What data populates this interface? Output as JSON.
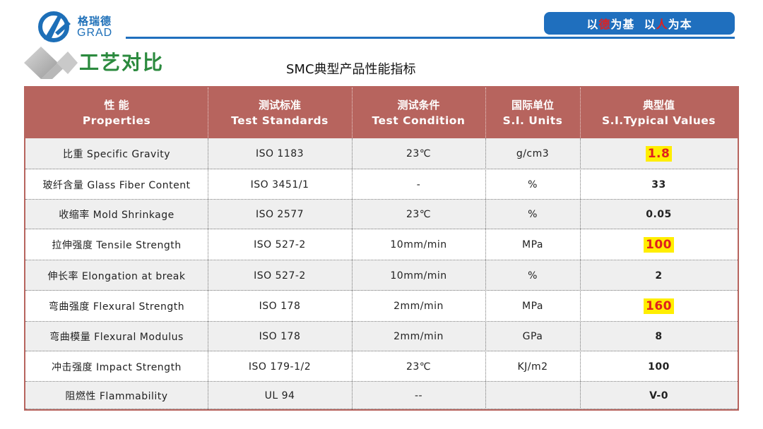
{
  "header": {
    "logo_cn": "格瑞德",
    "logo_en": "GRAD",
    "slogan": {
      "part1": "以",
      "part2": "德",
      "part3": "为基  以",
      "part4": "人",
      "part5": "为本"
    }
  },
  "section_title": "工艺对比",
  "table_title": "SMC典型产品性能指标",
  "table": {
    "headers": [
      {
        "cn": "性 能",
        "en": "Properties"
      },
      {
        "cn": "测试标准",
        "en": "Test Standards"
      },
      {
        "cn": "测试条件",
        "en": "Test Condition"
      },
      {
        "cn": "国际单位",
        "en": "S.I. Units"
      },
      {
        "cn": "典型值",
        "en": "S.I.Typical Values"
      }
    ],
    "rows": [
      {
        "property": "比重 Specific Gravity",
        "standard": "ISO 1183",
        "condition": "23℃",
        "unit": "g/cm3",
        "value": "1.8",
        "highlight": true
      },
      {
        "property": "玻纤含量 Glass Fiber Content",
        "standard": "ISO 3451/1",
        "condition": "-",
        "unit": "%",
        "value": "33",
        "highlight": false
      },
      {
        "property": "收缩率 Mold Shrinkage",
        "standard": "ISO 2577",
        "condition": "23℃",
        "unit": "%",
        "value": "0.05",
        "highlight": false
      },
      {
        "property": "拉伸强度 Tensile Strength",
        "standard": "ISO 527-2",
        "condition": "10mm/min",
        "unit": "MPa",
        "value": "100",
        "highlight": true
      },
      {
        "property": "伸长率 Elongation at break",
        "standard": "ISO 527-2",
        "condition": "10mm/min",
        "unit": "%",
        "value": "2",
        "highlight": false
      },
      {
        "property": "弯曲强度 Flexural Strength",
        "standard": "ISO 178",
        "condition": "2mm/min",
        "unit": "MPa",
        "value": "160",
        "highlight": true
      },
      {
        "property": "弯曲模量 Flexural Modulus",
        "standard": "ISO 178",
        "condition": "2mm/min",
        "unit": "GPa",
        "value": "8",
        "highlight": false
      },
      {
        "property": "冲击强度 Impact Strength",
        "standard": "ISO 179-1/2",
        "condition": "23℃",
        "unit": "KJ/m2",
        "value": "100",
        "highlight": false
      },
      {
        "property": "阻燃性 Flammability",
        "standard": "UL 94",
        "condition": "--",
        "unit": "",
        "value": "V-0",
        "highlight": false
      }
    ]
  },
  "colors": {
    "brand_blue": "#1f6fbe",
    "header_red": "#b7645e",
    "title_green": "#2b8a3e",
    "highlight_yellow": "#ffee00",
    "highlight_text_red": "#e0201e"
  },
  "icons": {
    "logo": "grad-logo-icon",
    "section": "diamond-bullet-icon"
  }
}
